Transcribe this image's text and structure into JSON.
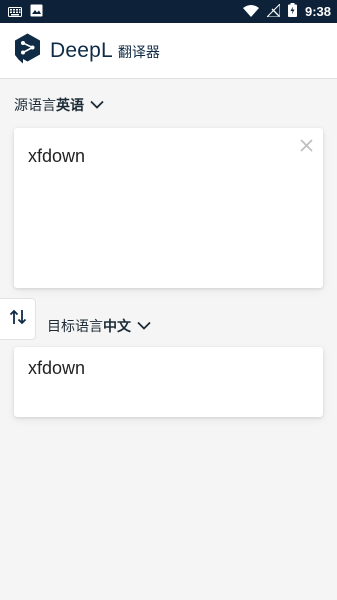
{
  "status_bar": {
    "time": "9:38",
    "left_icons": [
      "keyboard-icon",
      "image-icon"
    ],
    "right_icons": [
      "wifi-icon",
      "no-signal-icon",
      "battery-charging-icon"
    ]
  },
  "header": {
    "brand": "DeepL",
    "suffix": "翻译器"
  },
  "source": {
    "prefix": "源语言",
    "language": "英语",
    "text": "xfdown"
  },
  "target": {
    "prefix": "目标语言",
    "language": "中文",
    "text": "xfdown"
  },
  "colors": {
    "status_bar": "#0d2238",
    "brand": "#0f2b46",
    "background": "#f5f5f5"
  }
}
